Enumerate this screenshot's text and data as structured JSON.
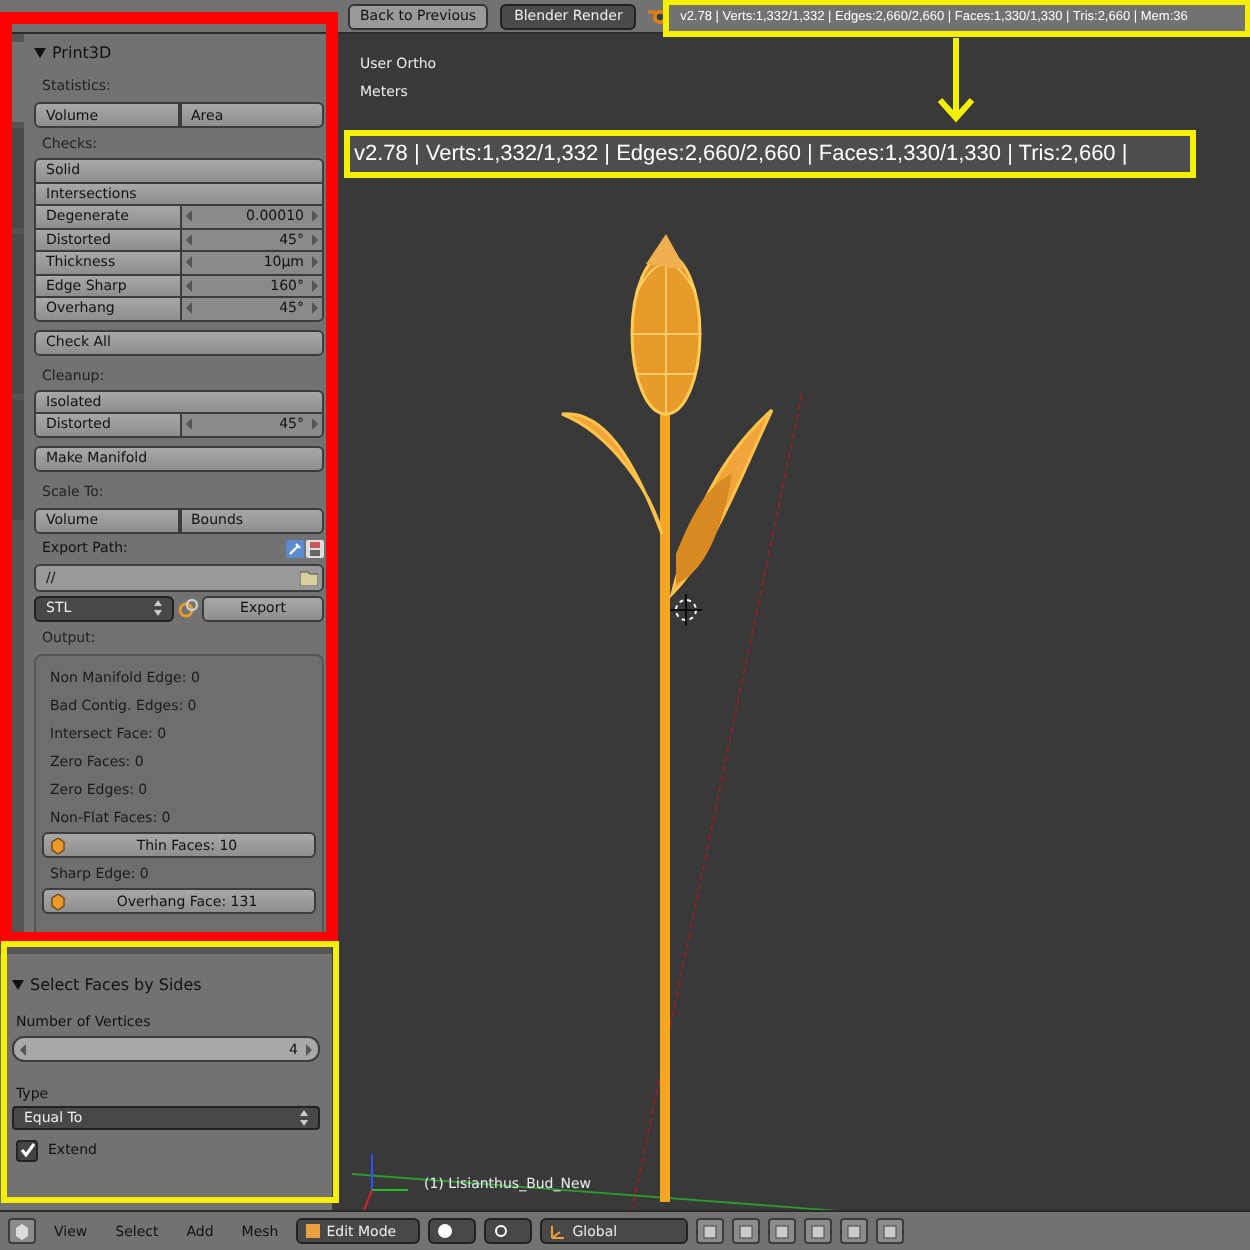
{
  "top_bar": {
    "back_button": "Back to Previous",
    "render_engine": "Blender Render",
    "stats": "v2.78 | Verts:1,332/1,332 | Edges:2,660/2,660 | Faces:1,330/1,330 | Tris:2,660 | Mem:36"
  },
  "viewport": {
    "view_name": "User Ortho",
    "units": "Meters",
    "object_label": "(1) Lisianthus_Bud_New",
    "callout": "v2.78 | Verts:1,332/1,332 | Edges:2,660/2,660 | Faces:1,330/1,330 | Tris:2,660 |"
  },
  "print3d": {
    "title": "Print3D",
    "expanded": true,
    "items": [
      {
        "kind": "label",
        "text": "Statistics:"
      },
      {
        "kind": "split",
        "buttons": [
          "Volume",
          "Area"
        ]
      },
      {
        "kind": "label",
        "text": "Checks:"
      },
      {
        "kind": "group",
        "items": [
          {
            "kind": "button",
            "text": "Solid"
          },
          {
            "kind": "button",
            "text": "Intersections"
          },
          {
            "kind": "number",
            "label": "Degenerate",
            "value": "0.00010"
          },
          {
            "kind": "number",
            "label": "Distorted",
            "value": "45°"
          },
          {
            "kind": "number",
            "label": "Thickness",
            "value": "10µm"
          },
          {
            "kind": "number",
            "label": "Edge Sharp",
            "value": "160°"
          },
          {
            "kind": "number",
            "label": "Overhang",
            "value": "45°"
          }
        ]
      },
      {
        "kind": "button",
        "text": "Check All"
      },
      {
        "kind": "label",
        "text": "Cleanup:"
      },
      {
        "kind": "group",
        "items": [
          {
            "kind": "button",
            "text": "Isolated"
          },
          {
            "kind": "number",
            "label": "Distorted",
            "value": "45°"
          }
        ]
      },
      {
        "kind": "button",
        "text": "Make Manifold"
      },
      {
        "kind": "label",
        "text": "Scale To:"
      },
      {
        "kind": "split",
        "buttons": [
          "Volume",
          "Bounds"
        ]
      },
      {
        "kind": "path",
        "label": "Export Path:",
        "value": "//"
      },
      {
        "kind": "export",
        "format": "STL",
        "button": "Export"
      },
      {
        "kind": "label",
        "text": "Output:"
      },
      {
        "kind": "output",
        "lines": [
          {
            "kind": "text",
            "text": "Non Manifold Edge: 0"
          },
          {
            "kind": "text",
            "text": "Bad Contig. Edges: 0"
          },
          {
            "kind": "text",
            "text": "Intersect Face: 0"
          },
          {
            "kind": "text",
            "text": "Zero Faces: 0"
          },
          {
            "kind": "text",
            "text": "Zero Edges: 0"
          },
          {
            "kind": "text",
            "text": "Non-Flat Faces: 0"
          },
          {
            "kind": "button",
            "text": "Thin Faces: 10"
          },
          {
            "kind": "text",
            "text": "Sharp Edge: 0"
          },
          {
            "kind": "button",
            "text": "Overhang Face: 131"
          }
        ]
      }
    ]
  },
  "operator_panel": {
    "title": "Select Faces by Sides",
    "expanded": true,
    "vertices_label": "Number of Vertices",
    "vertices_value": "4",
    "type_label": "Type",
    "type_value": "Equal To",
    "extend": {
      "label": "Extend",
      "checked": true
    }
  },
  "bottom_bar": {
    "menus": [
      "View",
      "Select",
      "Add",
      "Mesh"
    ],
    "mode": "Edit Mode",
    "orientation": "Global"
  }
}
